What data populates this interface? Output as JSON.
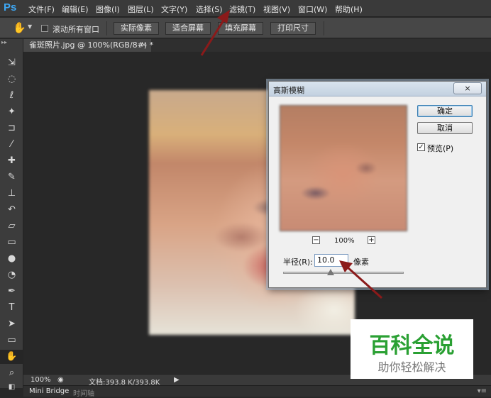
{
  "app": {
    "logo": "Ps"
  },
  "menu": {
    "items": [
      "文件(F)",
      "编辑(E)",
      "图像(I)",
      "图层(L)",
      "文字(Y)",
      "选择(S)",
      "滤镜(T)",
      "视图(V)",
      "窗口(W)",
      "帮助(H)"
    ]
  },
  "options": {
    "scroll_all_label": "滚动所有窗口",
    "scroll_all_checked": false,
    "buttons": [
      "实际像素",
      "适合屏幕",
      "填充屏幕",
      "打印尺寸"
    ]
  },
  "document": {
    "tab_title": "雀斑照片.jpg @ 100%(RGB/8#) *",
    "close_glyph": "×"
  },
  "status": {
    "zoom": "100%",
    "doc_info": "文档:393.8 K/393.8K"
  },
  "bottom_tabs": [
    "Mini Bridge",
    "时间轴"
  ],
  "dialog": {
    "title": "高斯模糊",
    "close_glyph": "×",
    "ok_label": "确定",
    "cancel_label": "取消",
    "preview_label": "预览(P)",
    "preview_checked": true,
    "zoom_level": "100%",
    "zoom_out_glyph": "−",
    "zoom_in_glyph": "+",
    "radius_label": "半径(R):",
    "radius_value": "10.0",
    "radius_unit": "像素"
  },
  "watermark": {
    "title": "百科全说",
    "subtitle": "助你轻松解决"
  },
  "colors": {
    "annotation_arrow": "#8b1a1a",
    "watermark_green": "#2aa033"
  }
}
